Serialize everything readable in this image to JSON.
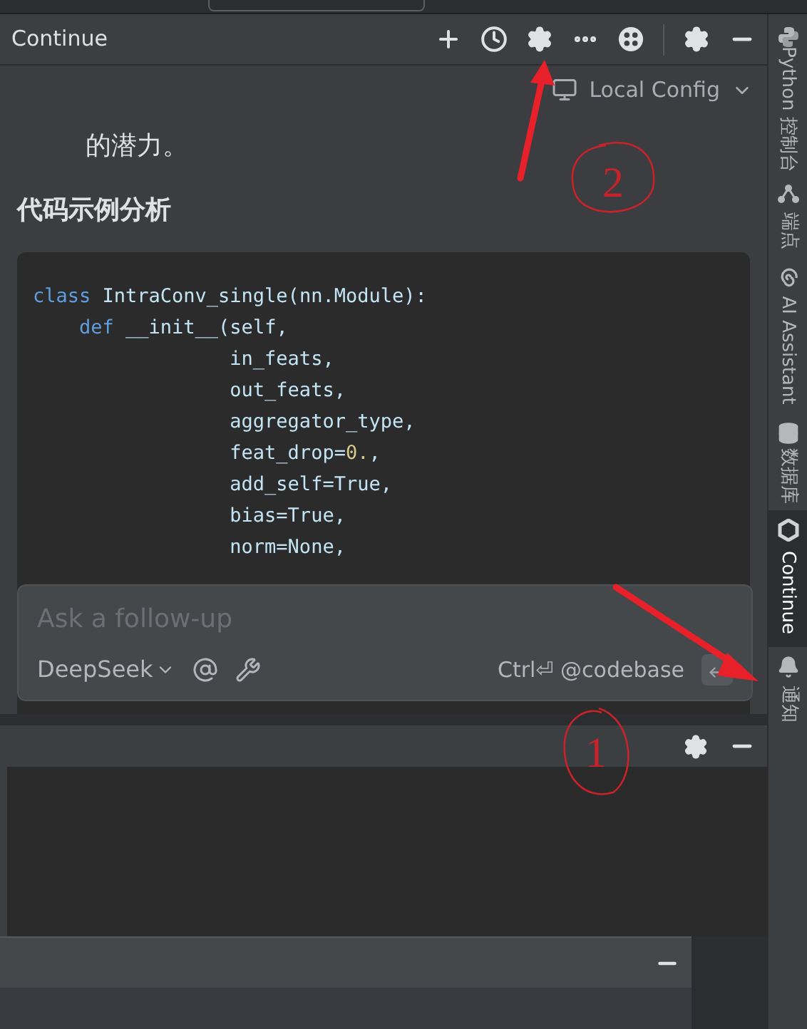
{
  "panel": {
    "title": "Continue"
  },
  "config": {
    "label": "Local Config"
  },
  "chat": {
    "text": "的潜力。",
    "heading": "代码示例分析",
    "code_lines": [
      [
        {
          "text": "class",
          "kind": "keyword"
        },
        {
          "text": " IntraConv_single(nn.Module):",
          "kind": "plain"
        }
      ],
      [
        {
          "text": "    def",
          "kind": "keyword"
        },
        {
          "text": " __init__(self,",
          "kind": "plain"
        }
      ],
      [
        {
          "text": "                 in_feats,",
          "kind": "plain"
        }
      ],
      [
        {
          "text": "                 out_feats,",
          "kind": "plain"
        }
      ],
      [
        {
          "text": "                 aggregator_type,",
          "kind": "plain"
        }
      ],
      [
        {
          "text": "                 feat_drop=",
          "kind": "plain"
        },
        {
          "text": "0.",
          "kind": "number"
        },
        {
          "text": ",",
          "kind": "plain"
        }
      ],
      [
        {
          "text": "                 add_self=True,",
          "kind": "plain"
        }
      ],
      [
        {
          "text": "                 bias=True,",
          "kind": "plain"
        }
      ],
      [
        {
          "text": "                 norm=None,",
          "kind": "plain"
        }
      ]
    ]
  },
  "input": {
    "placeholder": "Ask a follow-up",
    "model": "DeepSeek",
    "shortcut": "Ctrl⏎ @codebase"
  },
  "sidebar": {
    "items": [
      {
        "label": "Python 控制台",
        "selected": false
      },
      {
        "label": "端点",
        "selected": false
      },
      {
        "label": "AI Assistant",
        "selected": false
      },
      {
        "label": "数据库",
        "selected": false
      },
      {
        "label": "Continue",
        "selected": true
      },
      {
        "label": "通知",
        "selected": false
      }
    ]
  },
  "annotations": [
    {
      "label": "2"
    },
    {
      "label": "1"
    }
  ]
}
